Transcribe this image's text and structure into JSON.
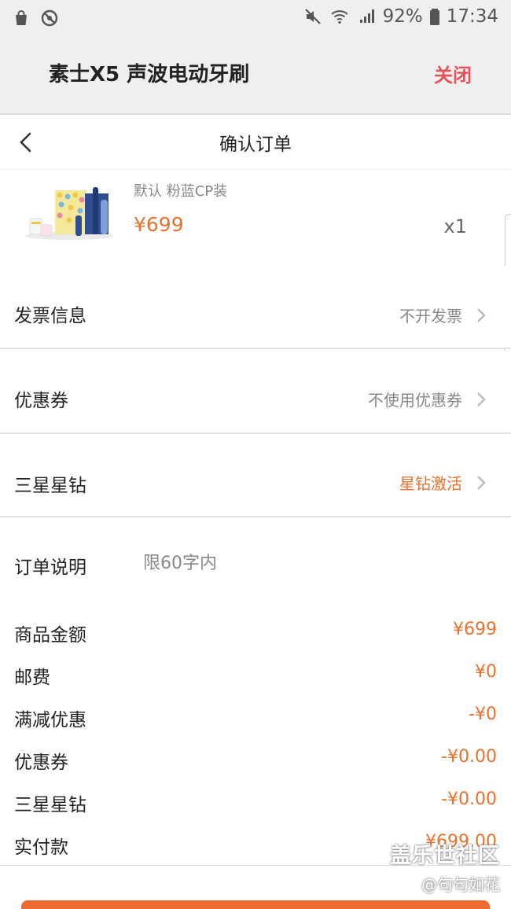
{
  "status_bar": {
    "icons_left": [
      "shopping-bag-icon",
      "no-disturb-icon"
    ],
    "icons_right": [
      "mute-icon",
      "wifi-icon",
      "signal-icon",
      "battery-icon"
    ],
    "battery": "92%",
    "time": "17:34"
  },
  "title_bar": {
    "title": "素士X5 声波电动牙刷",
    "close_label": "关闭",
    "close_color": "#e8505b"
  },
  "nav": {
    "title": "确认订单"
  },
  "product": {
    "variant": "默认 粉蓝CP装",
    "price": "¥699",
    "quantity": "x1"
  },
  "options": {
    "invoice": {
      "label": "发票信息",
      "value": "不开发票"
    },
    "coupon": {
      "label": "优惠券",
      "value": "不使用优惠券"
    },
    "samsung_diamond": {
      "label": "三星星钻",
      "value": "星钻激活"
    }
  },
  "order_note": {
    "label": "订单说明",
    "placeholder": "限60字内"
  },
  "summary": [
    {
      "label": "商品金额",
      "amount": "¥699"
    },
    {
      "label": "邮费",
      "amount": "¥0"
    },
    {
      "label": "满减优惠",
      "amount": "-¥0"
    },
    {
      "label": "优惠券",
      "amount": "-¥0.00"
    },
    {
      "label": "三星星钻",
      "amount": "-¥0.00"
    },
    {
      "label": "实付款",
      "amount": "¥699.00"
    }
  ],
  "watermark": {
    "line1": "盖乐世社区",
    "line2": "@句句如花"
  },
  "colors": {
    "accent": "#e8712e",
    "close": "#e8505b",
    "submit": "#ee6a2e"
  }
}
